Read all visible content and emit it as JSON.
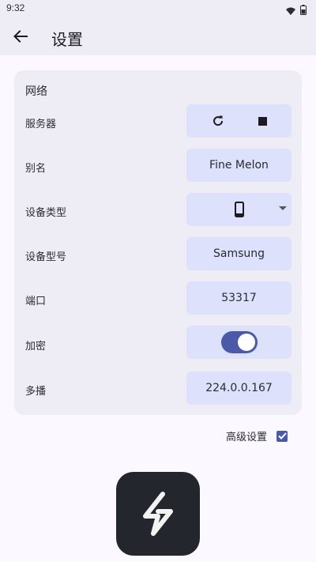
{
  "status": {
    "time": "9:32",
    "icons": [
      "wifi-icon",
      "battery-icon"
    ]
  },
  "appbar": {
    "title": "设置",
    "back_icon": "arrow-back-icon"
  },
  "network": {
    "section_title": "网络",
    "rows": [
      {
        "label": "服务器",
        "type": "buttons",
        "icons": [
          "refresh-icon",
          "stop-icon"
        ]
      },
      {
        "label": "别名",
        "type": "text",
        "value": "Fine Melon"
      },
      {
        "label": "设备类型",
        "type": "dropdown",
        "icon": "phone-icon"
      },
      {
        "label": "设备型号",
        "type": "text",
        "value": "Samsung"
      },
      {
        "label": "端口",
        "type": "text",
        "value": "53317"
      },
      {
        "label": "加密",
        "type": "toggle",
        "checked": true
      },
      {
        "label": "多播",
        "type": "text",
        "value": "224.0.0.167"
      }
    ]
  },
  "advanced": {
    "label": "高级设置",
    "checked": true
  },
  "colors": {
    "accent": "#4a5aa8",
    "field_bg": "#dde1fb",
    "card_bg": "#eeedf5",
    "logo_bg": "#23262d"
  }
}
